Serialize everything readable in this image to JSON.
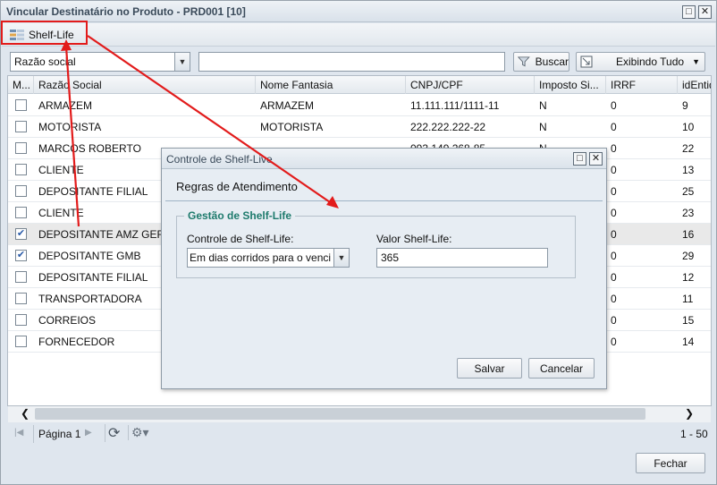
{
  "window": {
    "title": "Vincular Destinatário no Produto - PRD001 [10]",
    "maximize_glyph": "□",
    "close_glyph": "✕"
  },
  "toolbar": {
    "shelf_life_label": "Shelf-Life",
    "shelf_life_icon": "shelf-list-icon"
  },
  "filter": {
    "field_selected": "Razão social",
    "search_value": "",
    "search_button": "Buscar",
    "display_button": "Exibindo Tudo"
  },
  "grid": {
    "headers": [
      "M...",
      "Razão Social",
      "Nome Fantasia",
      "CNPJ/CPF",
      "Imposto Si...",
      "IRRF",
      "idEntid"
    ],
    "rows": [
      {
        "checked": false,
        "razao": "ARMAZEM",
        "fantasia": "ARMAZEM",
        "cnpj": "11.111.111/1111-11",
        "imposto": "N",
        "irrf": "0",
        "id": "9"
      },
      {
        "checked": false,
        "razao": "MOTORISTA",
        "fantasia": "MOTORISTA",
        "cnpj": "222.222.222-22",
        "imposto": "N",
        "irrf": "0",
        "id": "10"
      },
      {
        "checked": false,
        "razao": "MARCOS ROBERTO",
        "fantasia": "",
        "cnpj": "093.149.268-85",
        "imposto": "N",
        "irrf": "0",
        "id": "22"
      },
      {
        "checked": false,
        "razao": "CLIENTE",
        "fantasia": "",
        "cnpj": "",
        "imposto": "",
        "irrf": "0",
        "id": "13"
      },
      {
        "checked": false,
        "razao": "DEPOSITANTE FILIAL",
        "fantasia": "",
        "cnpj": "",
        "imposto": "",
        "irrf": "0",
        "id": "25"
      },
      {
        "checked": false,
        "razao": "CLIENTE",
        "fantasia": "",
        "cnpj": "",
        "imposto": "",
        "irrf": "0",
        "id": "23"
      },
      {
        "checked": true,
        "razao": "DEPOSITANTE AMZ GERAL",
        "fantasia": "",
        "cnpj": "",
        "imposto": "",
        "irrf": "0",
        "id": "16"
      },
      {
        "checked": true,
        "razao": "DEPOSITANTE GMB",
        "fantasia": "",
        "cnpj": "",
        "imposto": "",
        "irrf": "0",
        "id": "29"
      },
      {
        "checked": false,
        "razao": "DEPOSITANTE FILIAL",
        "fantasia": "",
        "cnpj": "",
        "imposto": "",
        "irrf": "0",
        "id": "12"
      },
      {
        "checked": false,
        "razao": "TRANSPORTADORA",
        "fantasia": "",
        "cnpj": "",
        "imposto": "",
        "irrf": "0",
        "id": "11"
      },
      {
        "checked": false,
        "razao": "CORREIOS",
        "fantasia": "",
        "cnpj": "",
        "imposto": "",
        "irrf": "0",
        "id": "15"
      },
      {
        "checked": false,
        "razao": "FORNECEDOR",
        "fantasia": "",
        "cnpj": "",
        "imposto": "",
        "irrf": "0",
        "id": "14"
      }
    ],
    "checkmark": "✔"
  },
  "scroll": {
    "left_glyph": "❮",
    "right_glyph": "❯"
  },
  "pager": {
    "first_glyph": "|◀",
    "page_label": "Página 1",
    "next_glyph": "▶",
    "refresh_glyph": "⟳",
    "gear_glyph": "⚙▾",
    "range": "1 - 50"
  },
  "footer": {
    "close_button": "Fechar"
  },
  "dialog": {
    "title": "Controle de Shelf-Live",
    "heading": "Regras de Atendimento",
    "group_title": "Gestão de Shelf-Life",
    "control_label": "Controle de Shelf-Life:",
    "control_value": "Em dias corridos para o venci",
    "value_label": "Valor Shelf-Life:",
    "value": "365",
    "save_button": "Salvar",
    "cancel_button": "Cancelar"
  },
  "annotation_color": "#e21b1b"
}
